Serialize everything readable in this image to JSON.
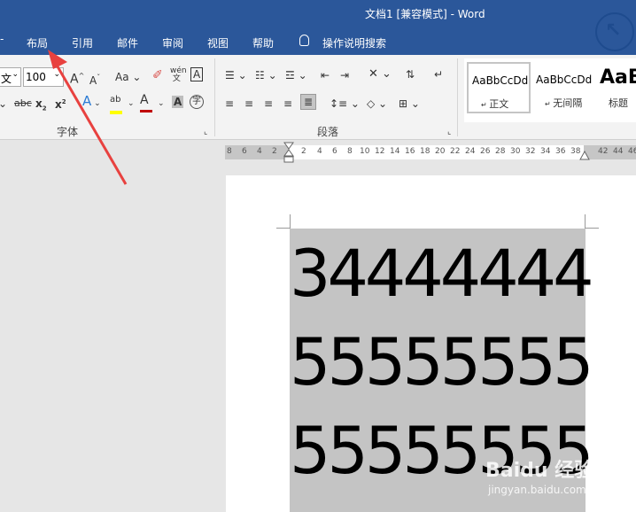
{
  "window": {
    "title": "文档1 [兼容模式]  -  Word"
  },
  "tabs": [
    {
      "label": "布局"
    },
    {
      "label": "引用"
    },
    {
      "label": "邮件"
    },
    {
      "label": "审阅"
    },
    {
      "label": "视图"
    },
    {
      "label": "帮助"
    }
  ],
  "tell_me": {
    "label": "操作说明搜索"
  },
  "font": {
    "name_fragment": "文",
    "size": "100"
  },
  "groups": {
    "font_label": "字体",
    "paragraph_label": "段落"
  },
  "styles": [
    {
      "preview": "AaBbCcDd",
      "name": "正文"
    },
    {
      "preview": "AaBbCcDd",
      "name": "无间隔"
    },
    {
      "preview": "AaB",
      "name": "标题"
    }
  ],
  "ruler": {
    "left_ticks": [
      "8",
      "6",
      "4",
      "2"
    ],
    "right_ticks": [
      "2",
      "4",
      "6",
      "8",
      "10",
      "12",
      "14",
      "16",
      "18",
      "20",
      "22",
      "24",
      "26",
      "28",
      "30",
      "32",
      "34",
      "36",
      "38"
    ],
    "far_ticks": [
      "42",
      "44",
      "46"
    ]
  },
  "document": {
    "lines": [
      "34444444",
      "55555555",
      "55555555"
    ]
  },
  "watermark": {
    "brand": "Baidu 经验",
    "url": "jingyan.baidu.com"
  },
  "colors": {
    "ribbon_blue": "#2b579a",
    "highlight_gray": "#c4c4c4",
    "arrow_red": "#e8413f",
    "font_color_red": "#c00000",
    "highlighter_yellow": "#ffff00"
  }
}
